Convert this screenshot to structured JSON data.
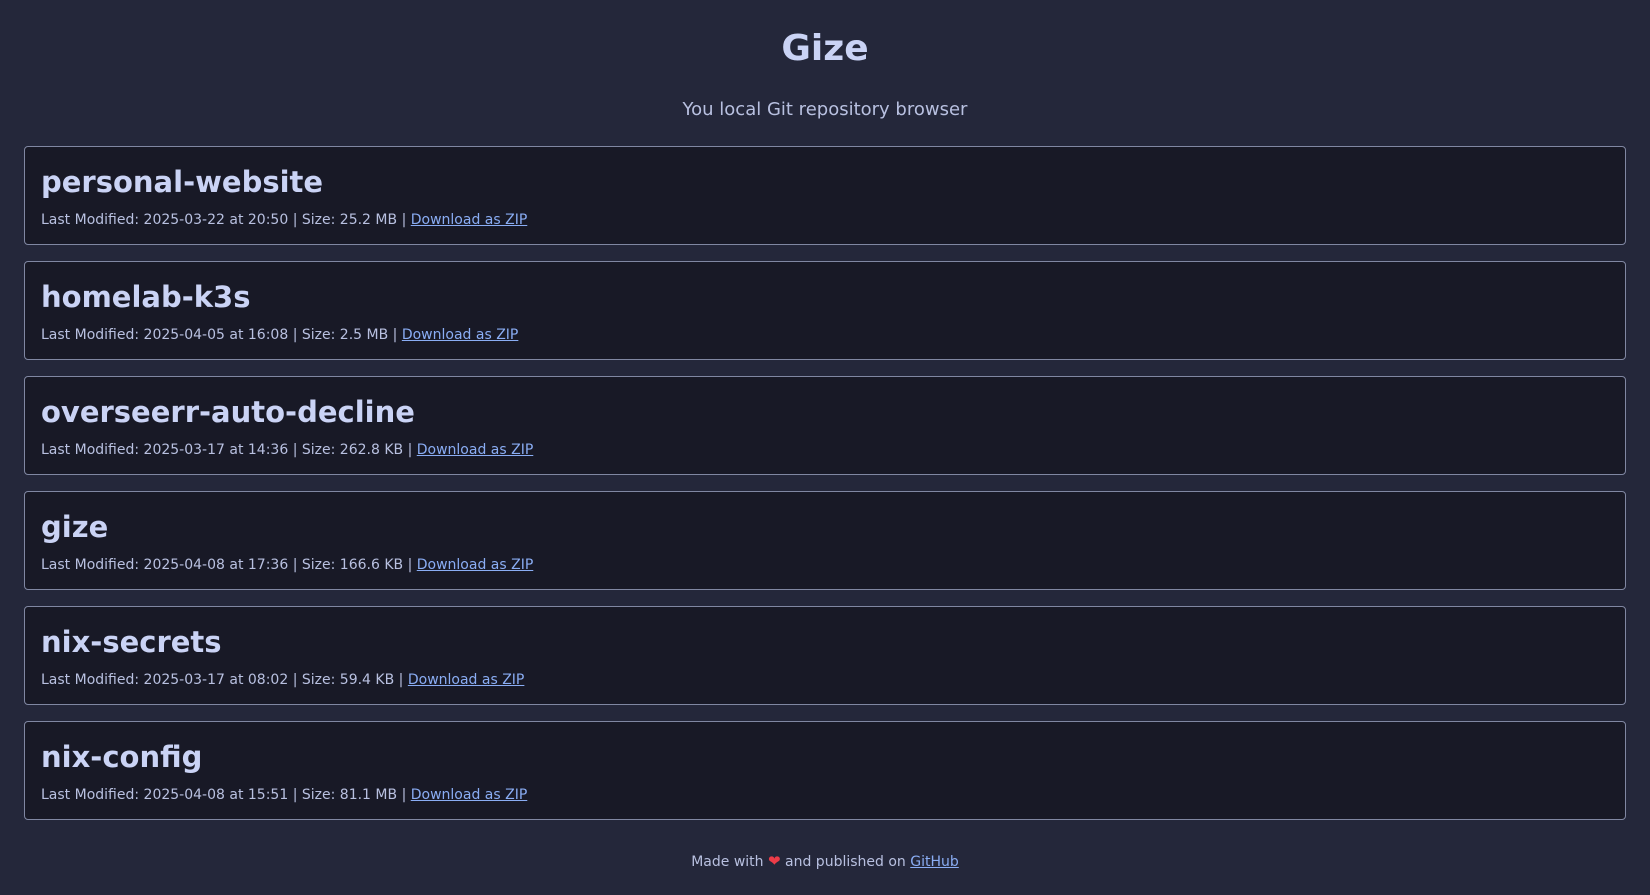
{
  "header": {
    "title": "Gize",
    "subtitle": "You local Git repository browser"
  },
  "labels": {
    "last_modified": "Last Modified:",
    "at": "at",
    "size": "Size:",
    "separator": "|",
    "download": "Download as ZIP"
  },
  "repos": [
    {
      "name": "personal-website",
      "date": "2025-03-22",
      "time": "20:50",
      "size": "25.2 MB"
    },
    {
      "name": "homelab-k3s",
      "date": "2025-04-05",
      "time": "16:08",
      "size": "2.5 MB"
    },
    {
      "name": "overseerr-auto-decline",
      "date": "2025-03-17",
      "time": "14:36",
      "size": "262.8 KB"
    },
    {
      "name": "gize",
      "date": "2025-04-08",
      "time": "17:36",
      "size": "166.6 KB"
    },
    {
      "name": "nix-secrets",
      "date": "2025-03-17",
      "time": "08:02",
      "size": "59.4 KB"
    },
    {
      "name": "nix-config",
      "date": "2025-04-08",
      "time": "15:51",
      "size": "81.1 MB"
    }
  ],
  "footer": {
    "prefix": "Made with",
    "heart_icon": "heart-icon",
    "middle": "and published on",
    "link": "GitHub"
  },
  "colors": {
    "background": "#24273a",
    "card_background": "#181926",
    "card_border": "#8087a2",
    "text": "#cad3f5",
    "link": "#8aadf4",
    "heart": "#ed3c48"
  }
}
